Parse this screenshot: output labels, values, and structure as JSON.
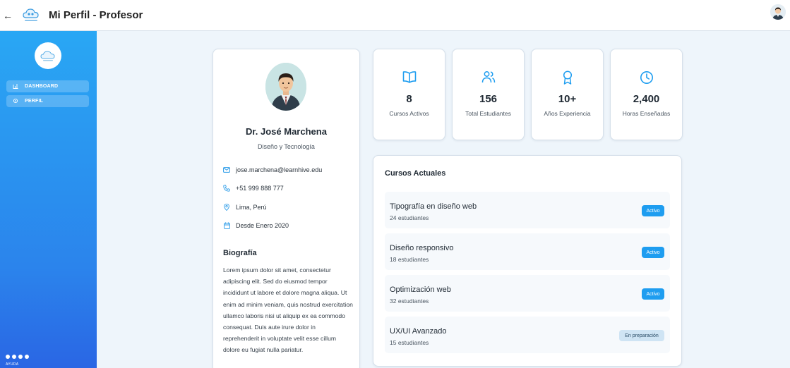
{
  "header": {
    "back_icon": "arrow-left-icon",
    "logo_icon": "learnhive-cloud-logo",
    "title": "Mi Perfil - Profesor",
    "user_avatar_icon": "user-avatar-icon"
  },
  "sidebar": {
    "items": [
      {
        "label": "DASHBOARD",
        "icon": "bar-chart-icon"
      },
      {
        "label": "PERFIL",
        "icon": "gear-icon"
      }
    ],
    "help_label": "AYUDA",
    "dot_count": 4
  },
  "profile": {
    "name": "Dr. José Marchena",
    "department": "Diseño y Tecnología",
    "email": "jose.marchena@learnhive.edu",
    "phone": "+51 999 888 777",
    "location": "Lima, Perú",
    "since": "Desde Enero 2020",
    "bio_heading": "Biografía",
    "bio": "Lorem ipsum dolor sit amet, consectetur adipiscing elit. Sed do eiusmod tempor incididunt ut labore et dolore magna aliqua. Ut enim ad minim veniam, quis nostrud exercitation ullamco laboris nisi ut aliquip ex ea commodo consequat. Duis aute irure dolor in reprehenderit in voluptate velit esse cillum dolore eu fugiat nulla pariatur."
  },
  "stats": [
    {
      "value": "8",
      "label": "Cursos Activos",
      "icon": "book-open-icon"
    },
    {
      "value": "156",
      "label": "Total Estudiantes",
      "icon": "users-icon"
    },
    {
      "value": "10+",
      "label": "Años Experiencia",
      "icon": "award-icon"
    },
    {
      "value": "2,400",
      "label": "Horas Enseñadas",
      "icon": "clock-icon"
    }
  ],
  "courses": {
    "heading": "Cursos Actuales",
    "items": [
      {
        "name": "Tipografía en diseño web",
        "students": "24 estudiantes",
        "status": "Activo"
      },
      {
        "name": "Diseño responsivo",
        "students": "18 estudiantes",
        "status": "Activo"
      },
      {
        "name": "Optimización web",
        "students": "32 estudiantes",
        "status": "Activo"
      },
      {
        "name": "UX/UI Avanzado",
        "students": "15 estudiantes",
        "status": "En preparación"
      }
    ]
  },
  "colors": {
    "accent": "#1e9df0",
    "sidebar_top": "#29a7f4",
    "sidebar_bottom": "#2a66e4",
    "page_bg": "#eef5fb",
    "badge_prep_bg": "#cfe4f4"
  }
}
